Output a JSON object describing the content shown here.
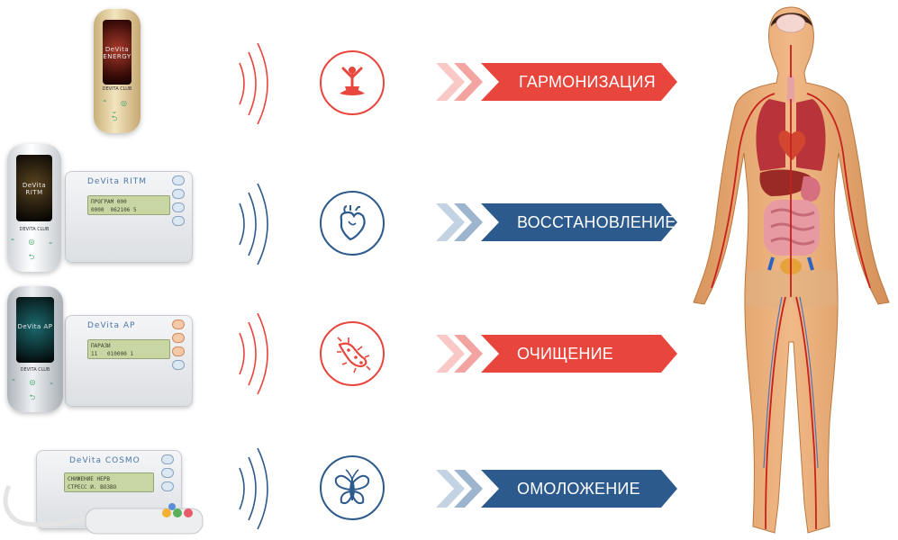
{
  "colors": {
    "red": "#e8453c",
    "red_light": "#f3a3a0",
    "red_pale": "#f8c9c7",
    "blue": "#2d5a8c",
    "blue_light": "#9db4cf",
    "blue_pale": "#c3d3e4"
  },
  "rows": [
    {
      "label": "ГАРМОНИЗАЦИЯ",
      "color": "red",
      "icon": "lotus-meditation-icon"
    },
    {
      "label": "ВОССТАНОВЛЕНИЕ",
      "color": "blue",
      "icon": "heart-organ-icon"
    },
    {
      "label": "ОЧИЩЕНИЕ",
      "color": "red",
      "icon": "bacteria-icon"
    },
    {
      "label": "ОМОЛОЖЕНИЕ",
      "color": "blue",
      "icon": "butterfly-icon"
    }
  ],
  "devices": {
    "energy": {
      "screen": "DeVita ENERGY",
      "brand": "DEVITA CLUB"
    },
    "ritm": {
      "screen": "DeVita RITM",
      "brand": "DEVITA CLUB",
      "panel_title": "DeVita RITM",
      "lcd": "ПРОГРАМ 000\n0000  062106 5"
    },
    "ap": {
      "screen": "DeVita AP",
      "brand": "DEVITA CLUB",
      "panel_title": "DeVita AP",
      "lcd": "ПАРАЗИ\n11   010000 1"
    },
    "cosmo": {
      "panel_title": "DeVita COSMO",
      "lcd": "СНИЖЕНИЕ НЕРВ\nСТРЕСС И. ВОЗВО"
    }
  }
}
